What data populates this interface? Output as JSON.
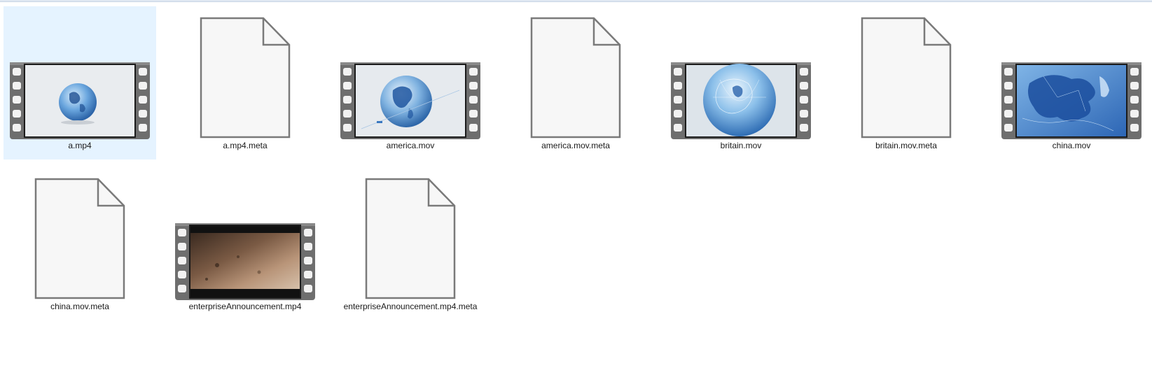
{
  "files": [
    {
      "name": "a.mp4",
      "type": "video",
      "selected": true,
      "thumb": "globe-small"
    },
    {
      "name": "a.mp4.meta",
      "type": "document",
      "selected": false
    },
    {
      "name": "america.mov",
      "type": "video",
      "selected": false,
      "thumb": "globe-america"
    },
    {
      "name": "america.mov.meta",
      "type": "document",
      "selected": false
    },
    {
      "name": "britain.mov",
      "type": "video",
      "selected": false,
      "thumb": "globe-britain"
    },
    {
      "name": "britain.mov.meta",
      "type": "document",
      "selected": false
    },
    {
      "name": "china.mov",
      "type": "video",
      "selected": false,
      "thumb": "map-china"
    },
    {
      "name": "china.mov.meta",
      "type": "document",
      "selected": false
    },
    {
      "name": "enterpriseAnnouncement.mp4",
      "type": "video",
      "selected": false,
      "thumb": "soil"
    },
    {
      "name": "enterpriseAnnouncement.mp4.meta",
      "type": "document",
      "selected": false
    }
  ],
  "colors": {
    "selection": "#e5f3ff",
    "film_frame": "#6e6e6e",
    "film_hole": "#f2f2f2",
    "doc_stroke": "#7a7a7a",
    "doc_fill": "#f7f7f7"
  },
  "icons": {
    "document": "document-icon",
    "video": "video-film-icon"
  }
}
